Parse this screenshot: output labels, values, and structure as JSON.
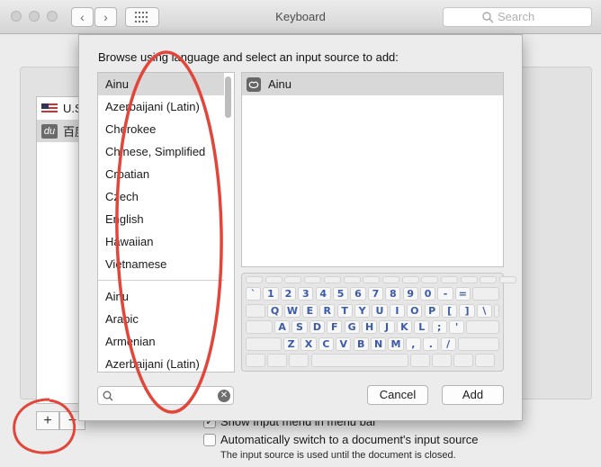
{
  "window": {
    "title": "Keyboard",
    "search_placeholder": "Search"
  },
  "background": {
    "sources": [
      {
        "label": "U.S.",
        "icon": "us-flag-icon"
      },
      {
        "label": "百度",
        "icon": "du-icon"
      }
    ],
    "add_label": "+",
    "remove_label": "−",
    "option_show_menu": "Show Input menu in menu bar",
    "option_auto_switch": "Automatically switch to a document's input source",
    "note": "The input source is used until the document is closed."
  },
  "sheet": {
    "prompt": "Browse using language and select an input source to add:",
    "languages_top": [
      "Ainu",
      "Azerbaijani (Latin)",
      "Cherokee",
      "Chinese, Simplified",
      "Croatian",
      "Czech",
      "English",
      "Hawaiian",
      "Vietnamese"
    ],
    "languages_bottom": [
      "Ainu",
      "Arabic",
      "Armenian",
      "Azerbaijani (Latin)"
    ],
    "selected_language": "Ainu",
    "input_sources": [
      {
        "label": "Ainu",
        "icon": "ainu-icon"
      }
    ],
    "keyboard_rows": [
      [
        "`",
        "1",
        "2",
        "3",
        "4",
        "5",
        "6",
        "7",
        "8",
        "9",
        "0",
        "-",
        "="
      ],
      [
        "Q",
        "W",
        "E",
        "R",
        "T",
        "Y",
        "U",
        "I",
        "O",
        "P",
        "[",
        "]",
        "\\"
      ],
      [
        "A",
        "S",
        "D",
        "F",
        "G",
        "H",
        "J",
        "K",
        "L",
        ";",
        "'"
      ],
      [
        "Z",
        "X",
        "C",
        "V",
        "B",
        "N",
        "M",
        ",",
        ".",
        "/"
      ]
    ],
    "filter_value": "",
    "cancel_label": "Cancel",
    "add_label": "Add"
  },
  "colors": {
    "annotation": "#e2463a",
    "key_text": "#3b5aa8",
    "selection": "#d8d8d8"
  }
}
